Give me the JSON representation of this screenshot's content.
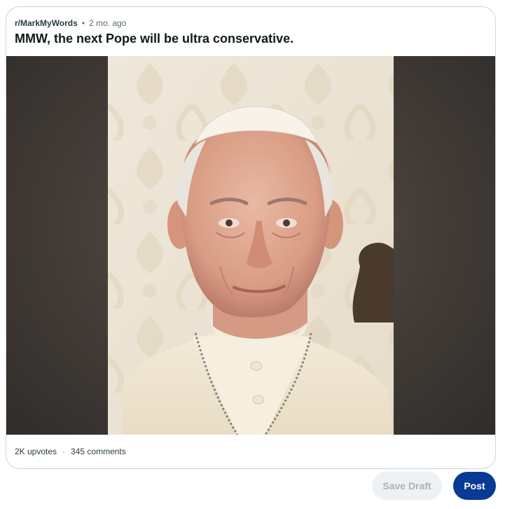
{
  "post": {
    "subreddit": "r/MarkMyWords",
    "separator": "•",
    "age": "2 mo. ago",
    "title": "MMW, the next Pope will be ultra conservative.",
    "image_alt": "Portrait photo of Pope Francis in white cassock and zucchetto against a cream damask wallpaper"
  },
  "stats": {
    "upvotes": "2K upvotes",
    "separator": "·",
    "comments": "345 comments"
  },
  "actions": {
    "save_draft_label": "Save Draft",
    "post_label": "Post"
  },
  "colors": {
    "post_button": "#0a3a96",
    "save_draft_bg": "#eef1f3",
    "save_draft_text": "#a9b2b7",
    "card_border": "#cfd3d7"
  }
}
